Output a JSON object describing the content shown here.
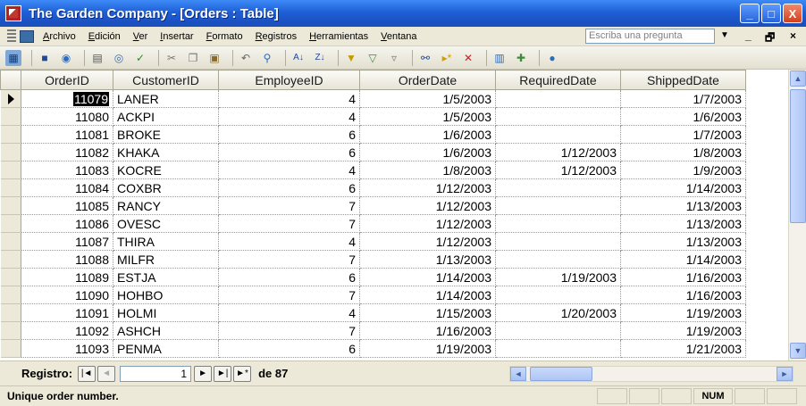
{
  "window": {
    "title": "The Garden Company - [Orders : Table]",
    "minimize": "_",
    "maximize": "□",
    "close": "X"
  },
  "menu": {
    "items": [
      "Archivo",
      "Edición",
      "Ver",
      "Insertar",
      "Formato",
      "Registros",
      "Herramientas",
      "Ventana"
    ],
    "help_placeholder": "Escriba una pregunta",
    "help_drop": "▼",
    "mdi_min": "_",
    "mdi_restore": "🗗",
    "mdi_close": "×"
  },
  "toolbar": {
    "icons": [
      "view-icon",
      "save-icon",
      "search-icon",
      "print-icon",
      "print-preview-icon",
      "spelling-icon",
      "cut-icon",
      "copy-icon",
      "paste-icon",
      "undo-icon",
      "insert-hyperlink-icon",
      "sort-ascending-icon",
      "sort-descending-icon",
      "filter-by-selection-icon",
      "filter-by-form-icon",
      "apply-filter-icon",
      "find-icon",
      "new-record-icon",
      "delete-record-icon",
      "database-window-icon",
      "new-object-icon",
      "help-icon"
    ]
  },
  "grid": {
    "columns": [
      "OrderID",
      "CustomerID",
      "EmployeeID",
      "OrderDate",
      "RequiredDate",
      "ShippedDate"
    ],
    "selected_row": 0,
    "rows": [
      [
        "11079",
        "LANER",
        "4",
        "1/5/2003",
        "",
        "1/7/2003"
      ],
      [
        "11080",
        "ACKPI",
        "4",
        "1/5/2003",
        "",
        "1/6/2003"
      ],
      [
        "11081",
        "BROKE",
        "6",
        "1/6/2003",
        "",
        "1/7/2003"
      ],
      [
        "11082",
        "KHAKA",
        "6",
        "1/6/2003",
        "1/12/2003",
        "1/8/2003"
      ],
      [
        "11083",
        "KOCRE",
        "4",
        "1/8/2003",
        "1/12/2003",
        "1/9/2003"
      ],
      [
        "11084",
        "COXBR",
        "6",
        "1/12/2003",
        "",
        "1/14/2003"
      ],
      [
        "11085",
        "RANCY",
        "7",
        "1/12/2003",
        "",
        "1/13/2003"
      ],
      [
        "11086",
        "OVESC",
        "7",
        "1/12/2003",
        "",
        "1/13/2003"
      ],
      [
        "11087",
        "THIRA",
        "4",
        "1/12/2003",
        "",
        "1/13/2003"
      ],
      [
        "11088",
        "MILFR",
        "7",
        "1/13/2003",
        "",
        "1/14/2003"
      ],
      [
        "11089",
        "ESTJA",
        "6",
        "1/14/2003",
        "1/19/2003",
        "1/16/2003"
      ],
      [
        "11090",
        "HOHBO",
        "7",
        "1/14/2003",
        "",
        "1/16/2003"
      ],
      [
        "11091",
        "HOLMI",
        "4",
        "1/15/2003",
        "1/20/2003",
        "1/19/2003"
      ],
      [
        "11092",
        "ASHCH",
        "7",
        "1/16/2003",
        "",
        "1/19/2003"
      ],
      [
        "11093",
        "PENMA",
        "6",
        "1/19/2003",
        "",
        "1/21/2003"
      ]
    ]
  },
  "navigation": {
    "label": "Registro:",
    "first": "|◄",
    "prev": "◄",
    "current": "1",
    "next": "►",
    "last": "►|",
    "new": "►*",
    "of_text": "de 87"
  },
  "status": {
    "text": "Unique order number.",
    "num": "NUM"
  }
}
